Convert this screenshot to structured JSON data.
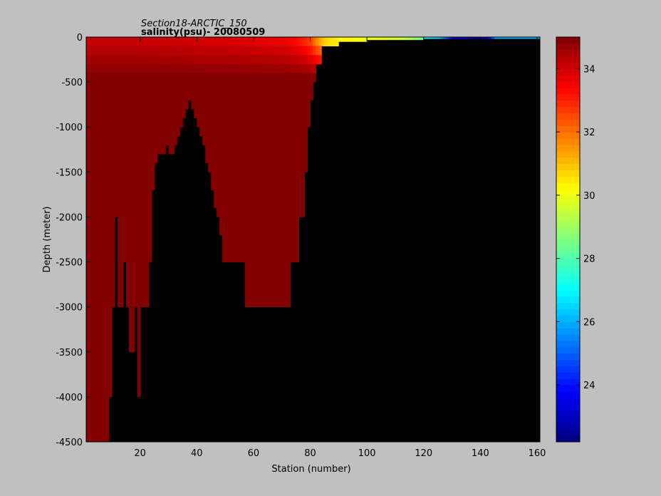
{
  "chart_data": {
    "type": "heatmap",
    "title_line1": "Section18-ARCTIC_150",
    "title_line2": "salinity(psu)- 20080509",
    "xlabel": "Station (number)",
    "ylabel": "Depth (meter)",
    "xlim": [
      1,
      161
    ],
    "ylim": [
      -4500,
      0
    ],
    "xticks": [
      20,
      40,
      60,
      80,
      100,
      120,
      140,
      160
    ],
    "yticks": [
      0,
      -500,
      -1000,
      -1500,
      -2000,
      -2500,
      -3000,
      -3500,
      -4000,
      -4500
    ],
    "colorbar": {
      "clim": [
        22.2,
        35.0
      ],
      "ticks": [
        24,
        26,
        28,
        30,
        32,
        34
      ]
    },
    "bottom_depth_by_station": [
      [
        1,
        -4500
      ],
      [
        8,
        -4500
      ],
      [
        9,
        -4000
      ],
      [
        10,
        -3000
      ],
      [
        11,
        -2000
      ],
      [
        12,
        -3000
      ],
      [
        14,
        -2500
      ],
      [
        15,
        -3000
      ],
      [
        16,
        -3500
      ],
      [
        18,
        -3000
      ],
      [
        19,
        -4000
      ],
      [
        20,
        -3000
      ],
      [
        23,
        -2500
      ],
      [
        24,
        -1700
      ],
      [
        25,
        -1400
      ],
      [
        26,
        -1300
      ],
      [
        29,
        -1200
      ],
      [
        30,
        -1300
      ],
      [
        32,
        -1200
      ],
      [
        33,
        -1100
      ],
      [
        34,
        -1000
      ],
      [
        35,
        -900
      ],
      [
        36,
        -800
      ],
      [
        37,
        -700
      ],
      [
        38,
        -800
      ],
      [
        39,
        -900
      ],
      [
        40,
        -1000
      ],
      [
        41,
        -1100
      ],
      [
        42,
        -1200
      ],
      [
        43,
        -1400
      ],
      [
        44,
        -1500
      ],
      [
        45,
        -1700
      ],
      [
        46,
        -1900
      ],
      [
        47,
        -2000
      ],
      [
        48,
        -2200
      ],
      [
        49,
        -2500
      ],
      [
        57,
        -3000
      ],
      [
        73,
        -2500
      ],
      [
        76,
        -2000
      ],
      [
        78,
        -1500
      ],
      [
        79,
        -1000
      ],
      [
        80,
        -700
      ],
      [
        81,
        -500
      ],
      [
        82,
        -300
      ],
      [
        84,
        -100
      ],
      [
        90,
        -50
      ],
      [
        100,
        -30
      ],
      [
        120,
        0
      ],
      [
        161,
        0
      ]
    ],
    "surface_salinity_by_station": [
      [
        1,
        34.0
      ],
      [
        20,
        34.0
      ],
      [
        40,
        33.8
      ],
      [
        60,
        33.6
      ],
      [
        70,
        33.4
      ],
      [
        75,
        33.0
      ],
      [
        78,
        32.5
      ],
      [
        80,
        32.0
      ],
      [
        82,
        31.0
      ],
      [
        85,
        30.0
      ],
      [
        90,
        29.5
      ],
      [
        100,
        29.2
      ],
      [
        110,
        28.8
      ],
      [
        115,
        28.0
      ],
      [
        120,
        27.0
      ],
      [
        125,
        26.5
      ],
      [
        130,
        23.5
      ],
      [
        138,
        23.0
      ],
      [
        142,
        23.0
      ],
      [
        145,
        26.0
      ],
      [
        161,
        26.0
      ]
    ]
  }
}
